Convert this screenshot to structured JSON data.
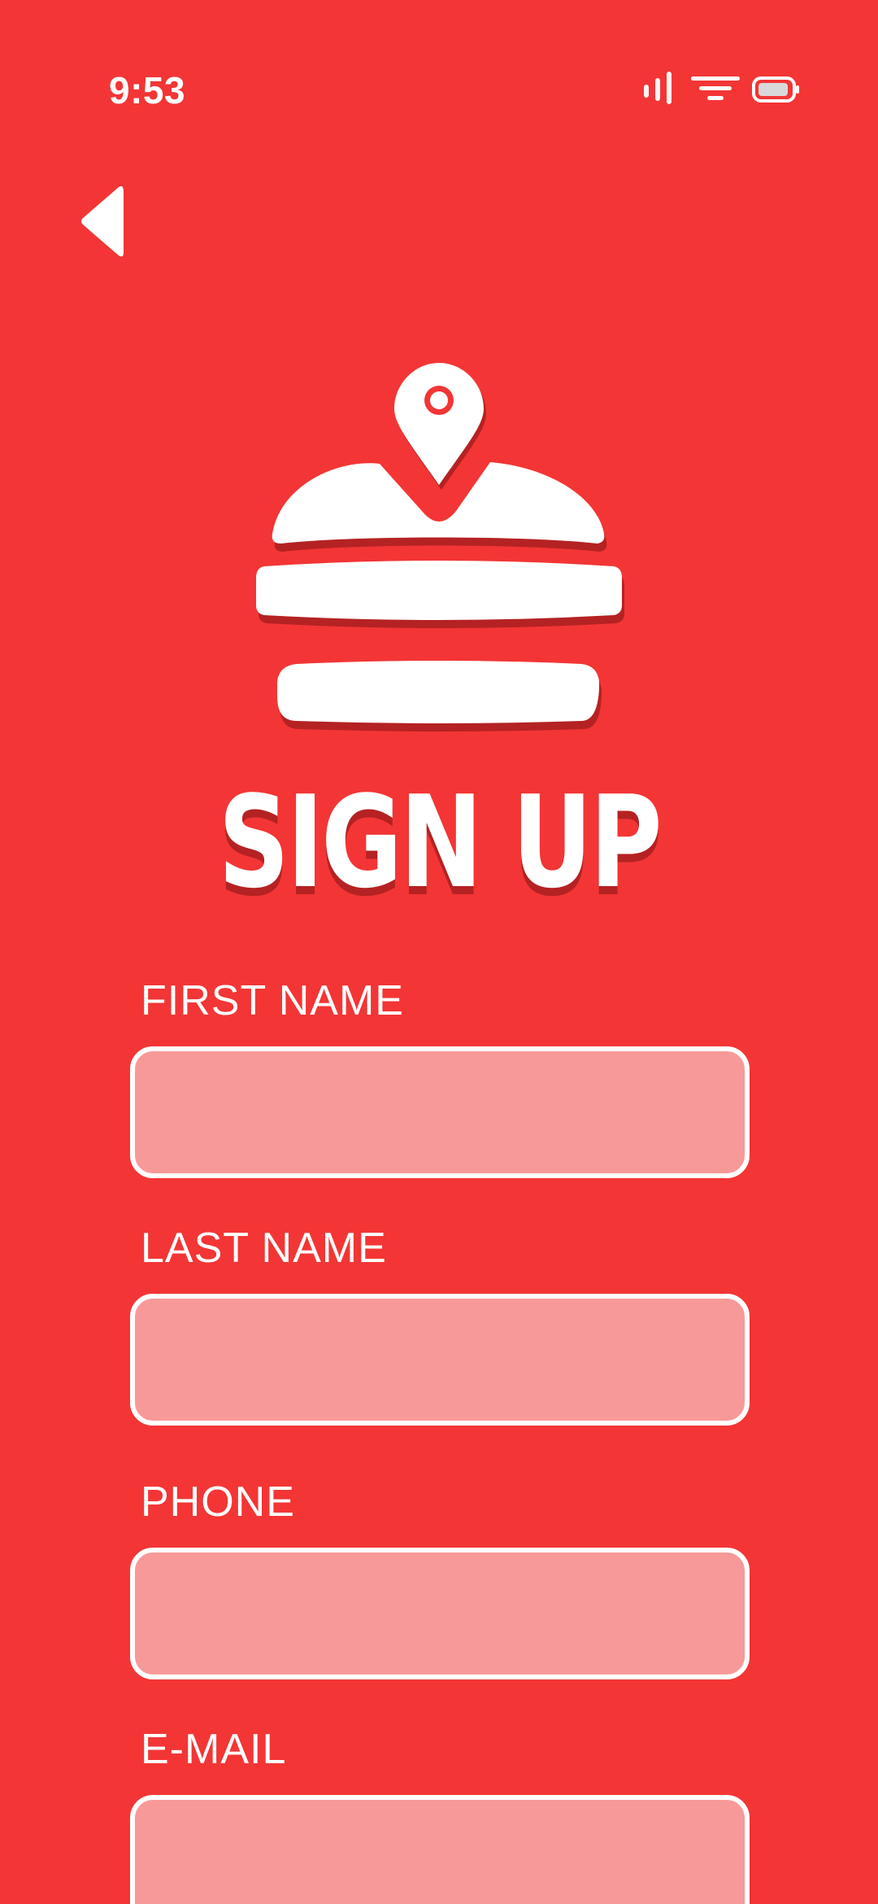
{
  "status_bar": {
    "time": "9:53",
    "icons": [
      "signal-icon",
      "wifi-icon",
      "battery-icon"
    ]
  },
  "navigation": {
    "back_icon": "back-arrow-icon"
  },
  "logo": {
    "icon": "burger-location-logo-icon"
  },
  "title": "SIGN UP",
  "form": {
    "fields": [
      {
        "label": "FIRST NAME",
        "value": "",
        "placeholder": ""
      },
      {
        "label": "LAST NAME",
        "value": "",
        "placeholder": ""
      },
      {
        "label": "PHONE",
        "value": "",
        "placeholder": ""
      },
      {
        "label": "E-MAIL",
        "value": "",
        "placeholder": ""
      }
    ]
  },
  "colors": {
    "background": "#F33535",
    "input_fill": "#F89999",
    "input_border": "#FFFFFF",
    "shadow": "#B52223",
    "text": "#FFFFFF"
  }
}
